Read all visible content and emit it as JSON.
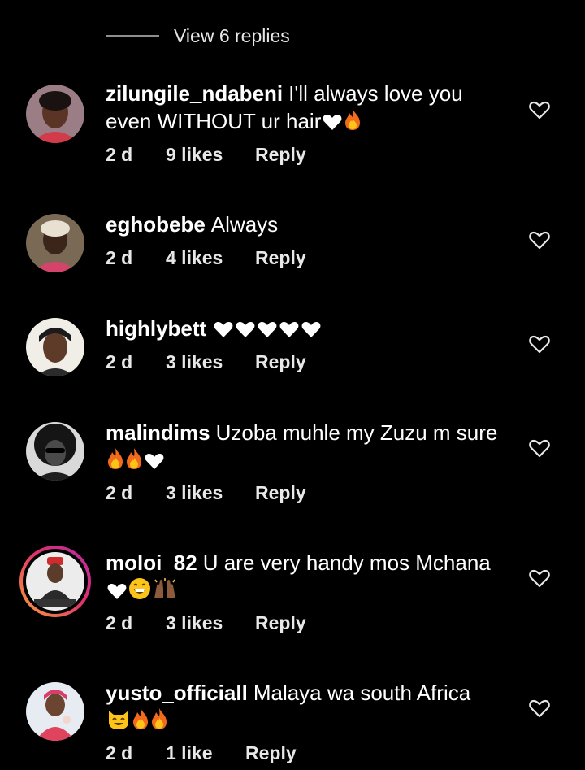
{
  "replies_toggle": {
    "label": "View 6 replies"
  },
  "comments": [
    {
      "username": "zilungile_ndabeni",
      "text": "I'll always love you even WITHOUT ur hair",
      "emojis": [
        "heart",
        "fire"
      ],
      "age": "2 d",
      "likes": "9 likes",
      "reply_label": "Reply"
    },
    {
      "username": "eghobebe",
      "text": "Always",
      "emojis": [],
      "age": "2 d",
      "likes": "4 likes",
      "reply_label": "Reply"
    },
    {
      "username": "highlybett",
      "text": "",
      "emojis": [
        "heart",
        "heart",
        "heart",
        "heart",
        "heart"
      ],
      "age": "2 d",
      "likes": "3 likes",
      "reply_label": "Reply"
    },
    {
      "username": "malindims",
      "text": "Uzoba muhle my Zuzu m sure",
      "emojis": [
        "fire",
        "fire",
        "heart"
      ],
      "age": "2 d",
      "likes": "3 likes",
      "reply_label": "Reply"
    },
    {
      "username": "moloi_82",
      "text": "U are very handy mos Mchana",
      "emojis": [
        "heart",
        "grin",
        "raised-hands"
      ],
      "age": "2 d",
      "likes": "3 likes",
      "reply_label": "Reply",
      "has_story_ring": true
    },
    {
      "username": "yusto_officiall",
      "text": "Malaya wa south Africa",
      "emojis": [
        "smiling-cat",
        "fire",
        "fire"
      ],
      "age": "2 d",
      "likes": "1 like",
      "reply_label": "Reply"
    }
  ],
  "colors": {
    "background": "#000000",
    "text": "#ffffff",
    "meta_text": "#e8e8e8",
    "divider": "#8e8e8e",
    "story_ring": "#e1306c"
  }
}
